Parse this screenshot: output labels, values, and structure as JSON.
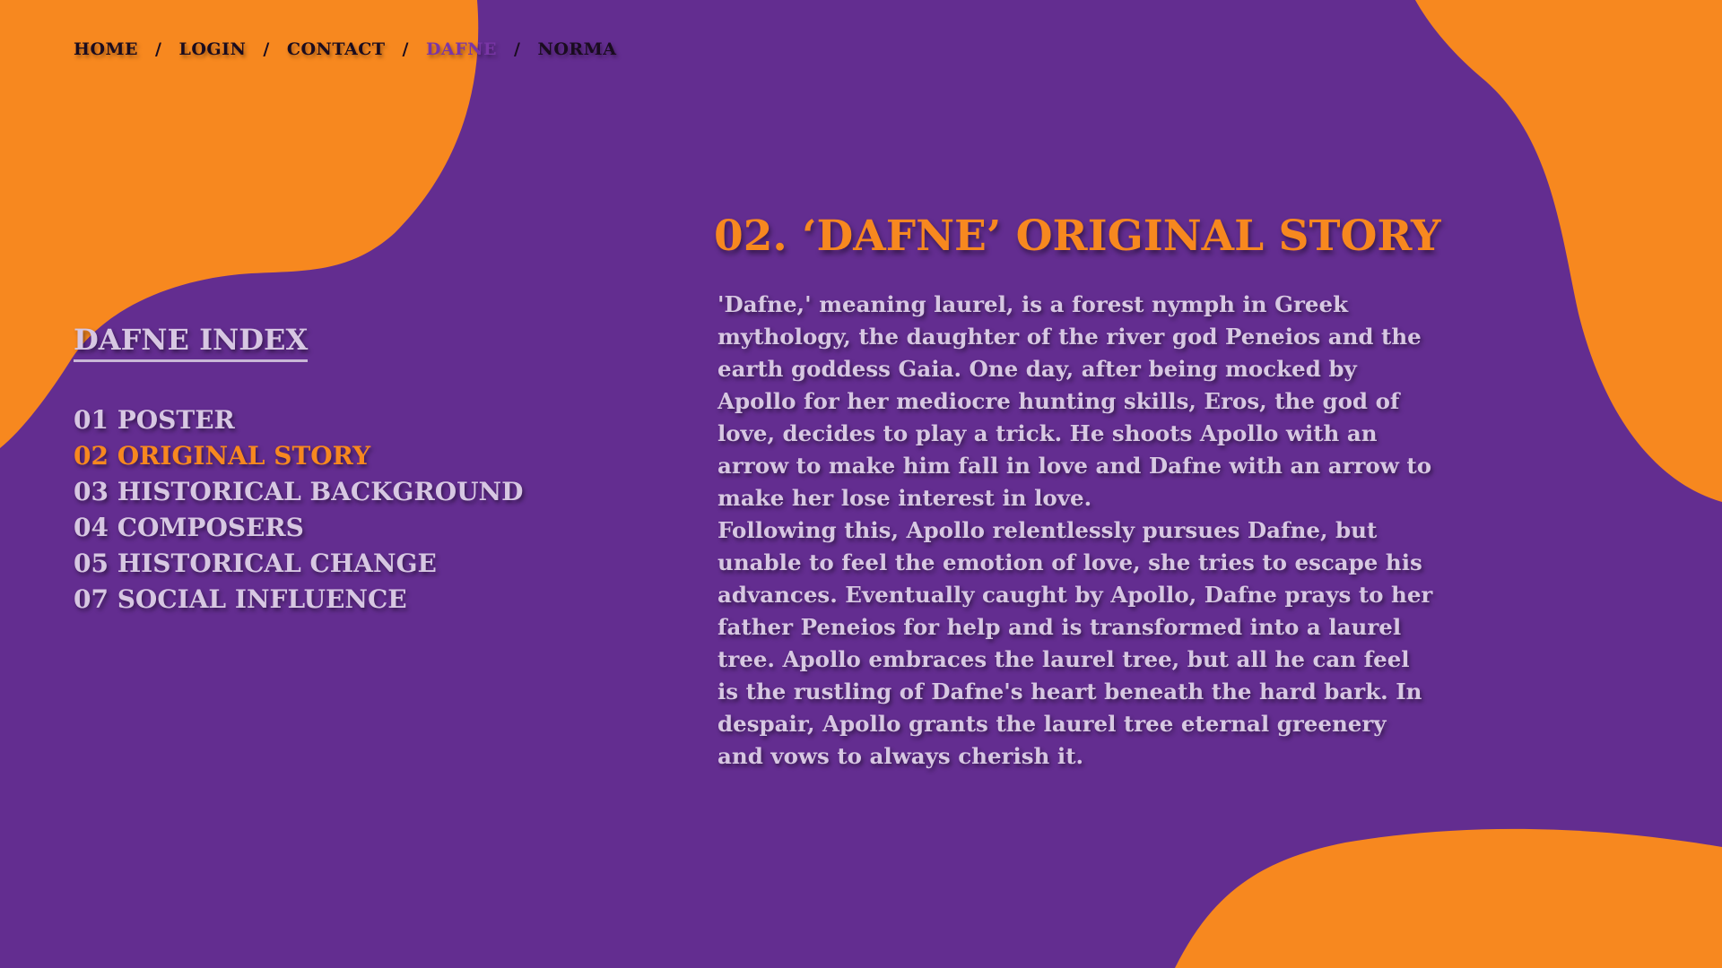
{
  "theme": {
    "background": "#632d90",
    "accent": "#f7881f",
    "text_light": "#d7c7e2",
    "nav_text": "#1a0c1f",
    "nav_active": "#7a36a6"
  },
  "nav": {
    "items": [
      {
        "label": "HOME"
      },
      {
        "label": "LOGIN"
      },
      {
        "label": "CONTACT"
      },
      {
        "label": "DAFNE",
        "active": true
      },
      {
        "label": "NORMA"
      }
    ],
    "separator": "/"
  },
  "index": {
    "title": "DAFNE INDEX",
    "items": [
      {
        "label": "01 POSTER"
      },
      {
        "label": "02 ORIGINAL STORY",
        "active": true
      },
      {
        "label": "03 HISTORICAL BACKGROUND"
      },
      {
        "label": "04 COMPOSERS"
      },
      {
        "label": "05 HISTORICAL CHANGE"
      },
      {
        "label": "07 SOCIAL INFLUENCE"
      }
    ]
  },
  "story": {
    "heading": "02. ‘DAFNE’ ORIGINAL STORY",
    "paragraphs": [
      "'Dafne,' meaning laurel, is a forest nymph in Greek mythology, the daughter of the river god Peneios and the earth goddess Gaia. One day, after being mocked by Apollo for her mediocre hunting skills, Eros, the god of love, decides to play a trick. He shoots Apollo with an arrow to make him fall in love and Dafne with an arrow to make her lose interest in love.",
      "Following this, Apollo relentlessly pursues Dafne, but unable to feel the emotion of love, she tries to escape his advances. Eventually caught by Apollo, Dafne prays to her father Peneios for help and is transformed into a laurel tree. Apollo embraces the laurel tree, but all he can feel is the rustling of Dafne's heart beneath the hard bark. In despair, Apollo grants the laurel tree eternal greenery and vows to always cherish it."
    ]
  }
}
